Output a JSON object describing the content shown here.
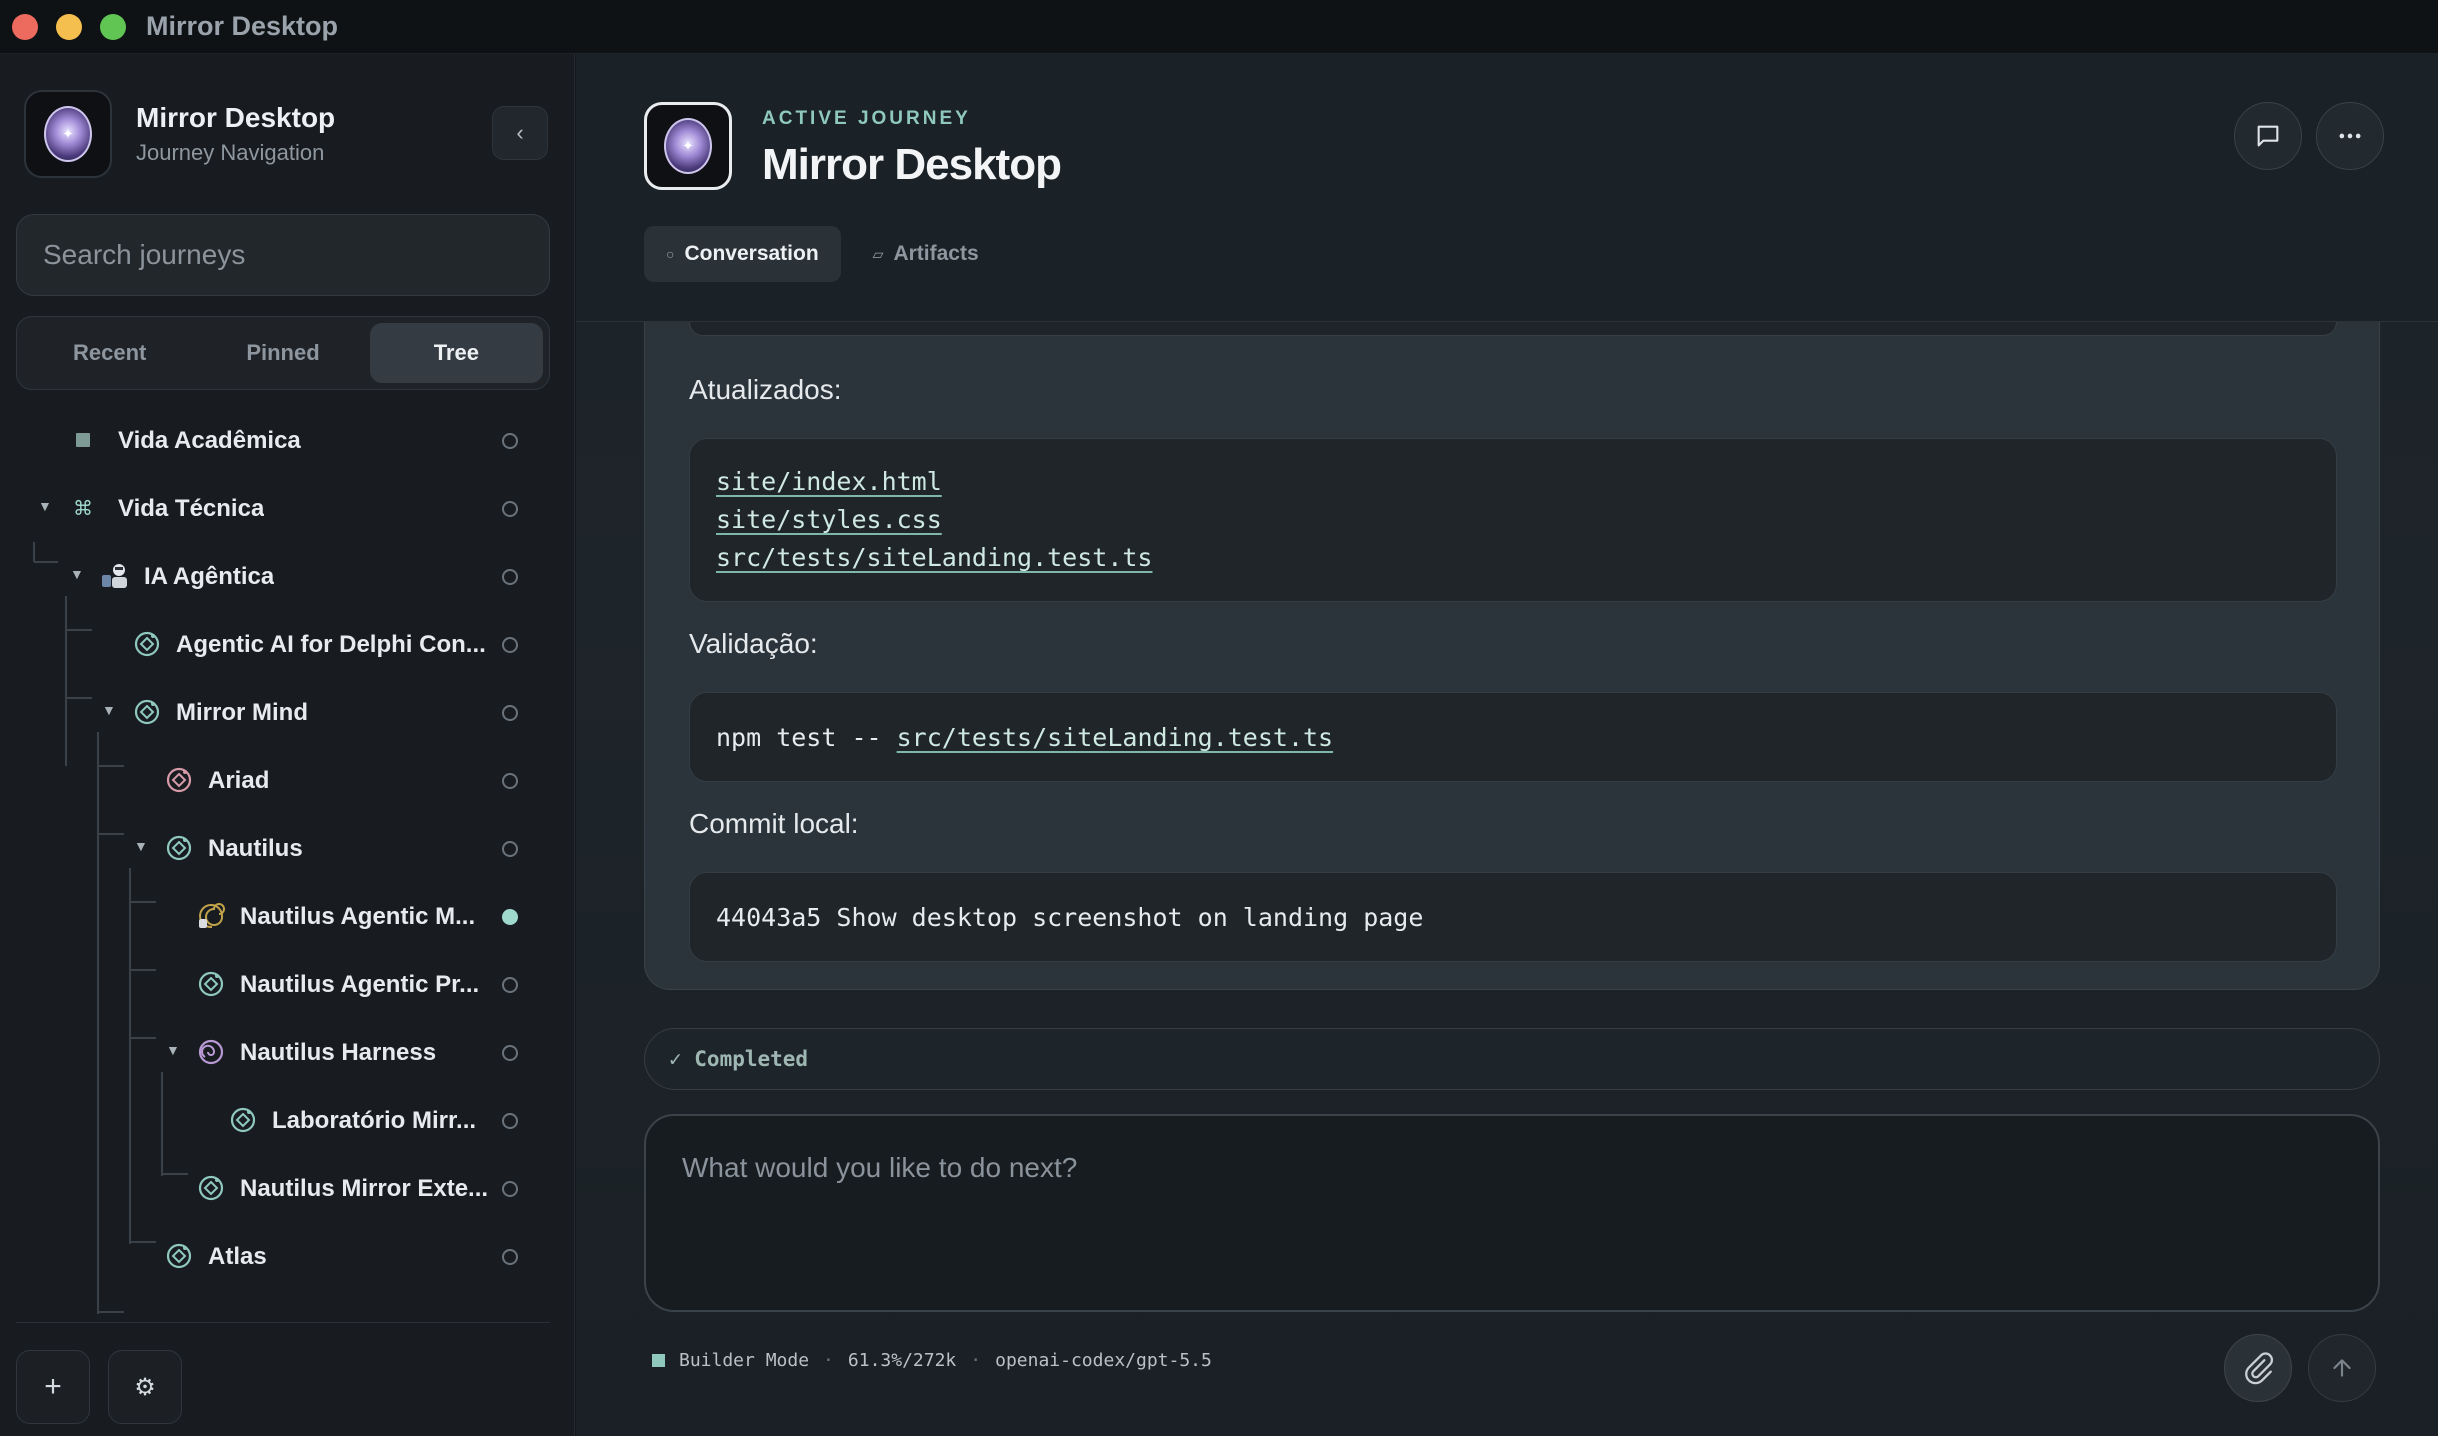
{
  "window": {
    "title": "Mirror Desktop"
  },
  "sidebar": {
    "brand_name": "Mirror Desktop",
    "brand_sub": "Journey Navigation",
    "collapse_glyph": "‹",
    "search_placeholder": "Search journeys",
    "segments": [
      "Recent",
      "Pinned",
      "Tree"
    ],
    "active_segment": "Tree",
    "tree": [
      {
        "label": "Vida Acadêmica",
        "icon": "square-icon",
        "expanded": false,
        "status": "idle"
      },
      {
        "label": "Vida Técnica",
        "icon": "command-icon",
        "expanded": true,
        "status": "idle"
      },
      {
        "label": "IA Agêntica",
        "icon": "robot-icon",
        "expanded": true,
        "status": "idle"
      },
      {
        "label": "Agentic AI for Delphi Con...",
        "icon": "target-icon",
        "expanded": false,
        "status": "idle"
      },
      {
        "label": "Mirror Mind",
        "icon": "target-icon",
        "expanded": true,
        "status": "idle"
      },
      {
        "label": "Ariad",
        "icon": "target-icon",
        "expanded": false,
        "status": "idle"
      },
      {
        "label": "Nautilus",
        "icon": "target-icon",
        "expanded": true,
        "status": "idle"
      },
      {
        "label": "Nautilus Agentic M...",
        "icon": "spiral-shell-icon",
        "expanded": false,
        "status": "active"
      },
      {
        "label": "Nautilus Agentic Pr...",
        "icon": "target-icon",
        "expanded": false,
        "status": "idle"
      },
      {
        "label": "Nautilus Harness",
        "icon": "spiral-icon",
        "expanded": true,
        "status": "idle"
      },
      {
        "label": "Laboratório Mirr...",
        "icon": "target-icon",
        "expanded": false,
        "status": "idle"
      },
      {
        "label": "Nautilus Mirror Exte...",
        "icon": "target-icon",
        "expanded": false,
        "status": "idle"
      },
      {
        "label": "Atlas",
        "icon": "target-icon",
        "expanded": false,
        "status": "idle"
      }
    ],
    "new_glyph": "+",
    "settings_glyph": "⚙"
  },
  "header": {
    "eyebrow": "ACTIVE JOURNEY",
    "title": "Mirror Desktop",
    "tabs": [
      {
        "label": "Conversation",
        "glyph": "○",
        "active": true
      },
      {
        "label": "Artifacts",
        "glyph": "▱",
        "active": false
      }
    ]
  },
  "conversation": {
    "updated_label": "Atualizados:",
    "updated_files": [
      "site/index.html",
      "site/styles.css",
      "src/tests/siteLanding.test.ts"
    ],
    "validation_label": "Validação:",
    "validation_cmd_prefix": "npm test -- ",
    "validation_cmd_file": "src/tests/siteLanding.test.ts",
    "commit_label": "Commit local:",
    "commit_line": "44043a5 Show desktop screenshot on landing page"
  },
  "status": {
    "text": "✓ Completed"
  },
  "composer": {
    "placeholder": "What would you like to do next?"
  },
  "footer": {
    "mode": "Builder Mode",
    "sep": "·",
    "context": "61.3%/272k",
    "model": "openai-codex/gpt-5.5"
  },
  "colors": {
    "accent": "#8fc9bd",
    "active_dot": "#9fd8cc",
    "bg": "#14181c"
  }
}
